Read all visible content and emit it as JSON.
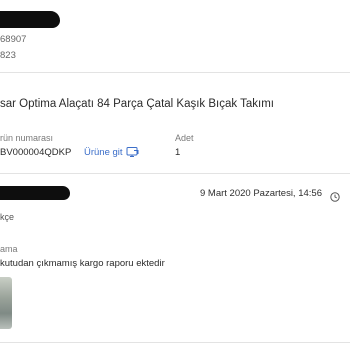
{
  "header": {
    "line_1": "68907",
    "line_2": "823"
  },
  "product": {
    "title": "sar Optima Alaçatı 84 Parça Çatal Kaşık Bıçak Takımı",
    "part_number_label": "rün numarası",
    "part_number": "BV000004QDKP",
    "go_to_product_label": "Ürüne git",
    "quantity_label": "Adet",
    "quantity": "1"
  },
  "return_request": {
    "date": "9 Mart 2020 Pazartesi, 14:56",
    "reason_label": "kçe",
    "description_label": "ama",
    "description": "kutudan çıkmamış kargo raporu ektedir"
  },
  "icons": {
    "go_to_product": "external-link-icon",
    "history": "clock-icon"
  },
  "colors": {
    "link": "#3b6ec9",
    "divider": "#e3e3e3"
  }
}
